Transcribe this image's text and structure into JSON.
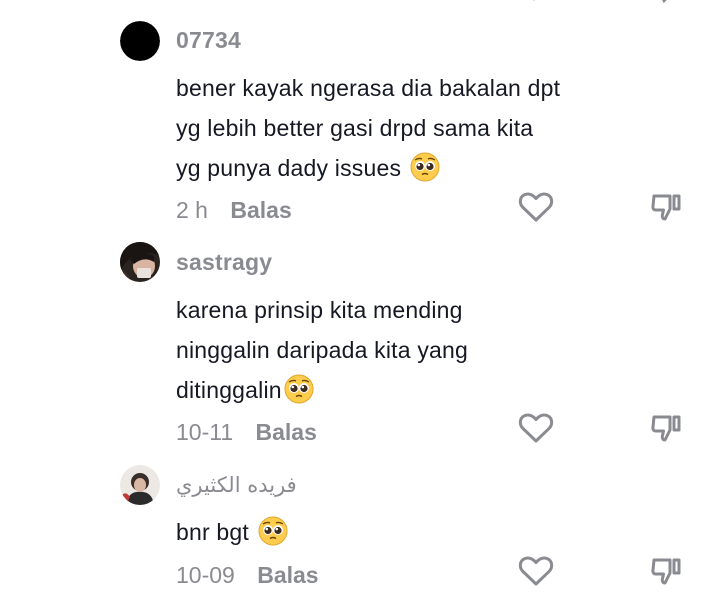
{
  "comments": [
    {
      "username": "07734",
      "lines": [
        "bener kayak ngerasa dia bakalan dpt",
        "yg lebih better gasi drpd sama kita",
        "yg punya dady issues"
      ],
      "emoji": "pleading-face",
      "time": "2 h",
      "reply_label": "Balas"
    },
    {
      "username": "sastragy",
      "lines": [
        "karena prinsip kita mending",
        "ninggalin daripada kita yang",
        "ditinggalin"
      ],
      "emoji": "pleading-face",
      "time": "10-11",
      "reply_label": "Balas"
    },
    {
      "username": "فريده الكثيري",
      "lines": [
        "bnr bgt"
      ],
      "emoji": "pleading-face",
      "time": "10-09",
      "reply_label": "Balas"
    }
  ],
  "icons": {
    "like": "heart-outline-icon",
    "dislike": "thumbs-down-outline-icon",
    "emoji": "pleading-face-emoji"
  },
  "colors": {
    "text": "#161823",
    "secondary": "#8a8b91",
    "background": "#ffffff"
  }
}
